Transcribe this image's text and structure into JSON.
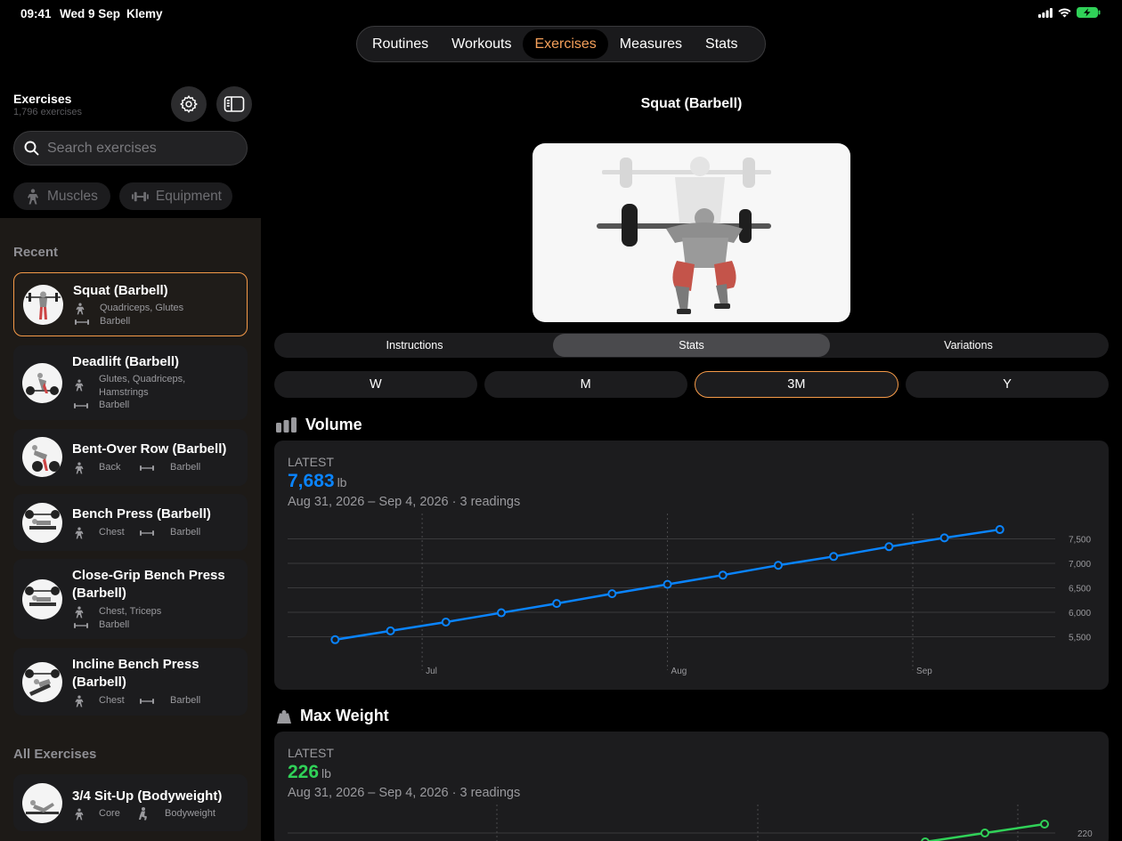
{
  "status": {
    "time": "09:41",
    "date": "Wed 9 Sep",
    "user": "Klemy"
  },
  "tabs": [
    {
      "label": "Routines",
      "active": false
    },
    {
      "label": "Workouts",
      "active": false
    },
    {
      "label": "Exercises",
      "active": true
    },
    {
      "label": "Measures",
      "active": false
    },
    {
      "label": "Stats",
      "active": false
    }
  ],
  "sidebar": {
    "title": "Exercises",
    "count": "1,796 exercises",
    "search_placeholder": "Search exercises",
    "filters": {
      "muscles": "Muscles",
      "equipment": "Equipment"
    },
    "recent_heading": "Recent",
    "all_heading": "All Exercises",
    "recent": [
      {
        "name": "Squat (Barbell)",
        "muscles": "Quadriceps, Glutes",
        "equipment": "Barbell",
        "selected": true
      },
      {
        "name": "Deadlift (Barbell)",
        "muscles": "Glutes, Quadriceps, Hamstrings",
        "equipment": "Barbell"
      },
      {
        "name": "Bent-Over Row (Barbell)",
        "muscles": "Back",
        "equipment": "Barbell"
      },
      {
        "name": "Bench Press (Barbell)",
        "muscles": "Chest",
        "equipment": "Barbell"
      },
      {
        "name": "Close-Grip Bench Press (Barbell)",
        "muscles": "Chest, Triceps",
        "equipment": "Barbell"
      },
      {
        "name": "Incline Bench Press (Barbell)",
        "muscles": "Chest",
        "equipment": "Barbell"
      }
    ],
    "all": [
      {
        "name": "3/4 Sit-Up (Bodyweight)",
        "muscles": "Core",
        "equipment": "Bodyweight"
      }
    ]
  },
  "detail": {
    "title": "Squat (Barbell)",
    "segments": [
      {
        "label": "Instructions",
        "active": false
      },
      {
        "label": "Stats",
        "active": true
      },
      {
        "label": "Variations",
        "active": false
      }
    ],
    "ranges": [
      {
        "label": "W",
        "active": false
      },
      {
        "label": "M",
        "active": false
      },
      {
        "label": "3M",
        "active": true
      },
      {
        "label": "Y",
        "active": false
      }
    ],
    "volume": {
      "heading": "Volume",
      "latest_label": "LATEST",
      "value": "7,683",
      "unit": "lb",
      "range_text": "Aug 31, 2026 – Sep 4, 2026 · 3 readings",
      "color": "#0a84ff"
    },
    "max_weight": {
      "heading": "Max Weight",
      "latest_label": "LATEST",
      "value": "226",
      "unit": "lb",
      "range_text": "Aug 31, 2026 – Sep 4, 2026 · 3 readings",
      "color": "#30d158"
    }
  },
  "chart_data": [
    {
      "type": "line",
      "name": "Volume",
      "x_ticks": [
        "Jul",
        "Aug",
        "Sep"
      ],
      "y_ticks": [
        5500,
        6000,
        6500,
        7000,
        7500
      ],
      "ylim": [
        5440,
        7750
      ],
      "x": [
        "2026-06-20",
        "2026-06-27",
        "2026-07-04",
        "2026-07-11",
        "2026-07-18",
        "2026-07-25",
        "2026-08-01",
        "2026-08-08",
        "2026-08-15",
        "2026-08-22",
        "2026-08-29",
        "2026-09-05",
        "2026-09-12"
      ],
      "values": [
        5440,
        5620,
        5800,
        5990,
        6180,
        6380,
        6570,
        6760,
        6960,
        7140,
        7340,
        7520,
        7690
      ],
      "color": "#0a84ff",
      "grid": true
    },
    {
      "type": "line",
      "name": "Max Weight",
      "y_ticks": [
        220
      ],
      "values": [
        218,
        220,
        222
      ],
      "color": "#30d158",
      "grid": true
    }
  ]
}
